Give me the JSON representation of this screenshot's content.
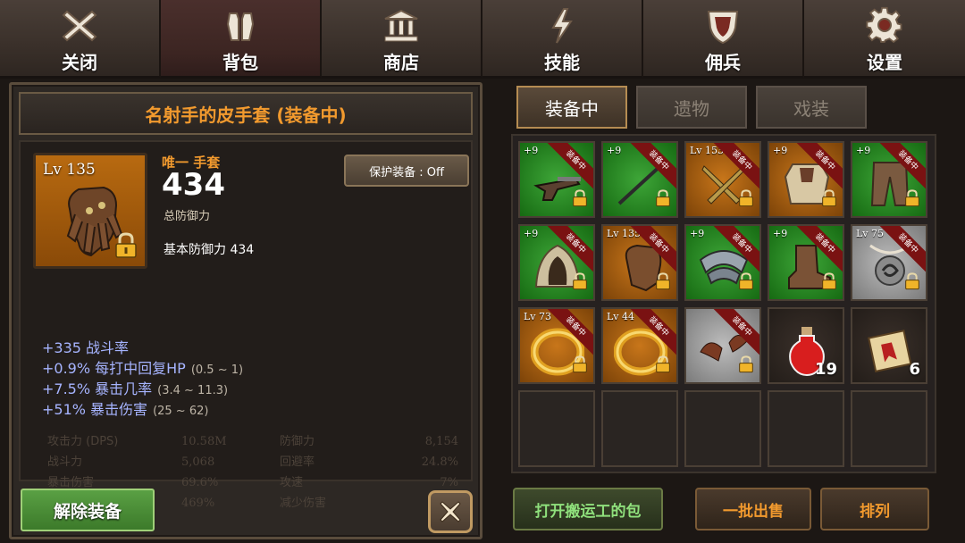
{
  "nav": {
    "tabs": [
      {
        "label": "关闭",
        "icon": "close-icon"
      },
      {
        "label": "背包",
        "icon": "backpack-icon"
      },
      {
        "label": "商店",
        "icon": "shop-icon"
      },
      {
        "label": "技能",
        "icon": "skill-icon"
      },
      {
        "label": "佣兵",
        "icon": "mercenary-shield-icon"
      },
      {
        "label": "设置",
        "icon": "gear-icon"
      }
    ],
    "active": "背包"
  },
  "detail": {
    "title": "名射手的皮手套 (装备中)",
    "portrait_level": "Lv 135",
    "item_type": "唯一 手套",
    "defense_value": "434",
    "defense_label": "总防御力",
    "base_stat": "基本防御力 434",
    "protect_button": "保护装备 : Off",
    "bonuses": [
      {
        "text": "+335 战斗率",
        "range": ""
      },
      {
        "text": "+0.9% 每打中回复HP",
        "range": "(0.5 ~ 1)"
      },
      {
        "text": "+7.5% 暴击几率",
        "range": "(3.4 ~ 11.3)"
      },
      {
        "text": "+51% 暴击伤害",
        "range": "(25 ~ 62)"
      }
    ],
    "background_stats": [
      {
        "l1": "攻击力 (DPS)",
        "v1": "10.58M",
        "l2": "防御力",
        "v2": "8,154"
      },
      {
        "l1": "战斗力",
        "v1": "5,068",
        "l2": "回避率",
        "v2": "24.8%"
      },
      {
        "l1": "暴击伤害",
        "v1": "69.6%",
        "l2": "攻速",
        "v2": "7%"
      },
      {
        "l1": "",
        "v1": "469%",
        "l2": "减少伤害",
        "v2": ""
      }
    ],
    "unequip_button": "解除装备"
  },
  "inventory": {
    "tabs": [
      "装备中",
      "遗物",
      "戏装"
    ],
    "active_tab": "装备中",
    "equipped_badge": "装备中",
    "slots": [
      {
        "bg": "green",
        "level": "+9",
        "equipped": true,
        "locked": true,
        "item": "pistol"
      },
      {
        "bg": "green",
        "level": "+9",
        "equipped": true,
        "locked": true,
        "item": "spear"
      },
      {
        "bg": "orange",
        "level": "Lv 153",
        "equipped": true,
        "locked": true,
        "item": "daggers"
      },
      {
        "bg": "orange",
        "level": "+9",
        "equipped": true,
        "locked": true,
        "item": "chest-armor"
      },
      {
        "bg": "green",
        "level": "+9",
        "equipped": true,
        "locked": true,
        "item": "pants"
      },
      {
        "bg": "green",
        "level": "+9",
        "equipped": true,
        "locked": true,
        "item": "hood"
      },
      {
        "bg": "orange",
        "level": "Lv 135",
        "equipped": true,
        "locked": true,
        "item": "gloves"
      },
      {
        "bg": "green",
        "level": "+9",
        "equipped": true,
        "locked": true,
        "item": "pauldron"
      },
      {
        "bg": "green",
        "level": "+9",
        "equipped": true,
        "locked": true,
        "item": "boots"
      },
      {
        "bg": "gray",
        "level": "Lv 75",
        "equipped": true,
        "locked": true,
        "item": "amulet"
      },
      {
        "bg": "orange",
        "level": "Lv 73",
        "equipped": true,
        "locked": true,
        "item": "ring"
      },
      {
        "bg": "orange",
        "level": "Lv 44",
        "equipped": true,
        "locked": true,
        "item": "ring"
      },
      {
        "bg": "gray",
        "level": "",
        "equipped": true,
        "locked": true,
        "item": "wings"
      },
      {
        "bg": "dark",
        "level": "",
        "equipped": false,
        "locked": false,
        "item": "potion",
        "count": "19"
      },
      {
        "bg": "dark",
        "level": "",
        "equipped": false,
        "locked": false,
        "item": "scroll",
        "count": "6"
      },
      {
        "bg": "empty",
        "level": "",
        "equipped": false,
        "locked": false,
        "item": ""
      },
      {
        "bg": "empty",
        "level": "",
        "equipped": false,
        "locked": false,
        "item": ""
      },
      {
        "bg": "empty",
        "level": "",
        "equipped": false,
        "locked": false,
        "item": ""
      },
      {
        "bg": "empty",
        "level": "",
        "equipped": false,
        "locked": false,
        "item": ""
      },
      {
        "bg": "empty",
        "level": "",
        "equipped": false,
        "locked": false,
        "item": ""
      }
    ],
    "buttons": {
      "porter": "打开搬运工的包",
      "sell": "一批出售",
      "sort": "排列"
    }
  },
  "colors": {
    "accent_orange": "#f29a2e",
    "bonus_blue": "#a6b4ff",
    "green_button": "#4a8f36"
  }
}
